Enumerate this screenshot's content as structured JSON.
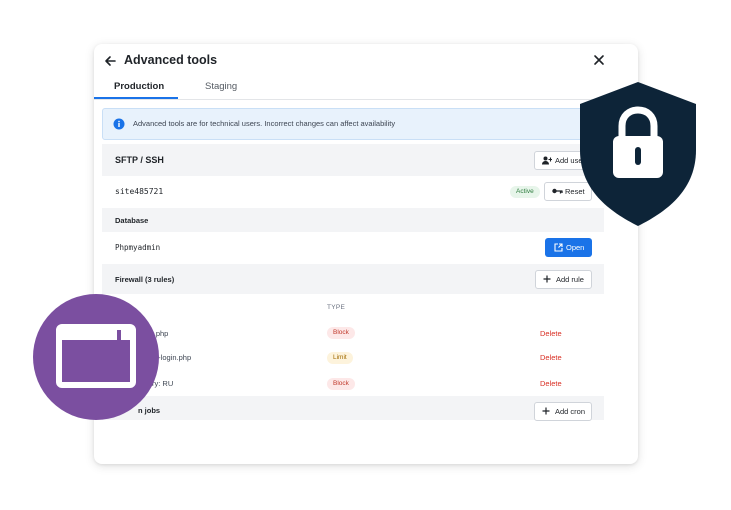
{
  "dialog": {
    "title": "Advanced tools",
    "tabs": [
      {
        "label": "Production",
        "active": true
      },
      {
        "label": "Staging",
        "active": false
      }
    ]
  },
  "banner": {
    "text": "Advanced tools are for technical users. Incorrect changes can affect availability",
    "icon": "info-icon"
  },
  "sftp": {
    "title": "SFTP / SSH",
    "add_user_label": "Add user",
    "username": "site485721",
    "status": "Active",
    "reset_label": "Reset"
  },
  "database": {
    "title": "Database",
    "name": "Phpmyadmin",
    "open_label": "Open"
  },
  "firewall": {
    "title": "Firewall (3 rules)",
    "add_rule_label": "Add rule",
    "type_header": "TYPE",
    "rules": [
      {
        "target": "xmlrpc.php",
        "visible_target": "c.php",
        "type": "Block",
        "action": "Delete"
      },
      {
        "target": "wp-login.php",
        "visible_target": "b-login.php",
        "type": "Limit",
        "action": "Delete"
      },
      {
        "target": "Country: RU",
        "visible_target": "ry: RU",
        "type": "Block",
        "action": "Delete"
      }
    ]
  },
  "cron": {
    "title": "Cron jobs",
    "visible_title": "n jobs",
    "add_label": "Add cron"
  },
  "colors": {
    "accent": "#1a73e8",
    "shield": "#0d2438",
    "window_badge": "#7b4fa0",
    "delete": "#d93025"
  }
}
